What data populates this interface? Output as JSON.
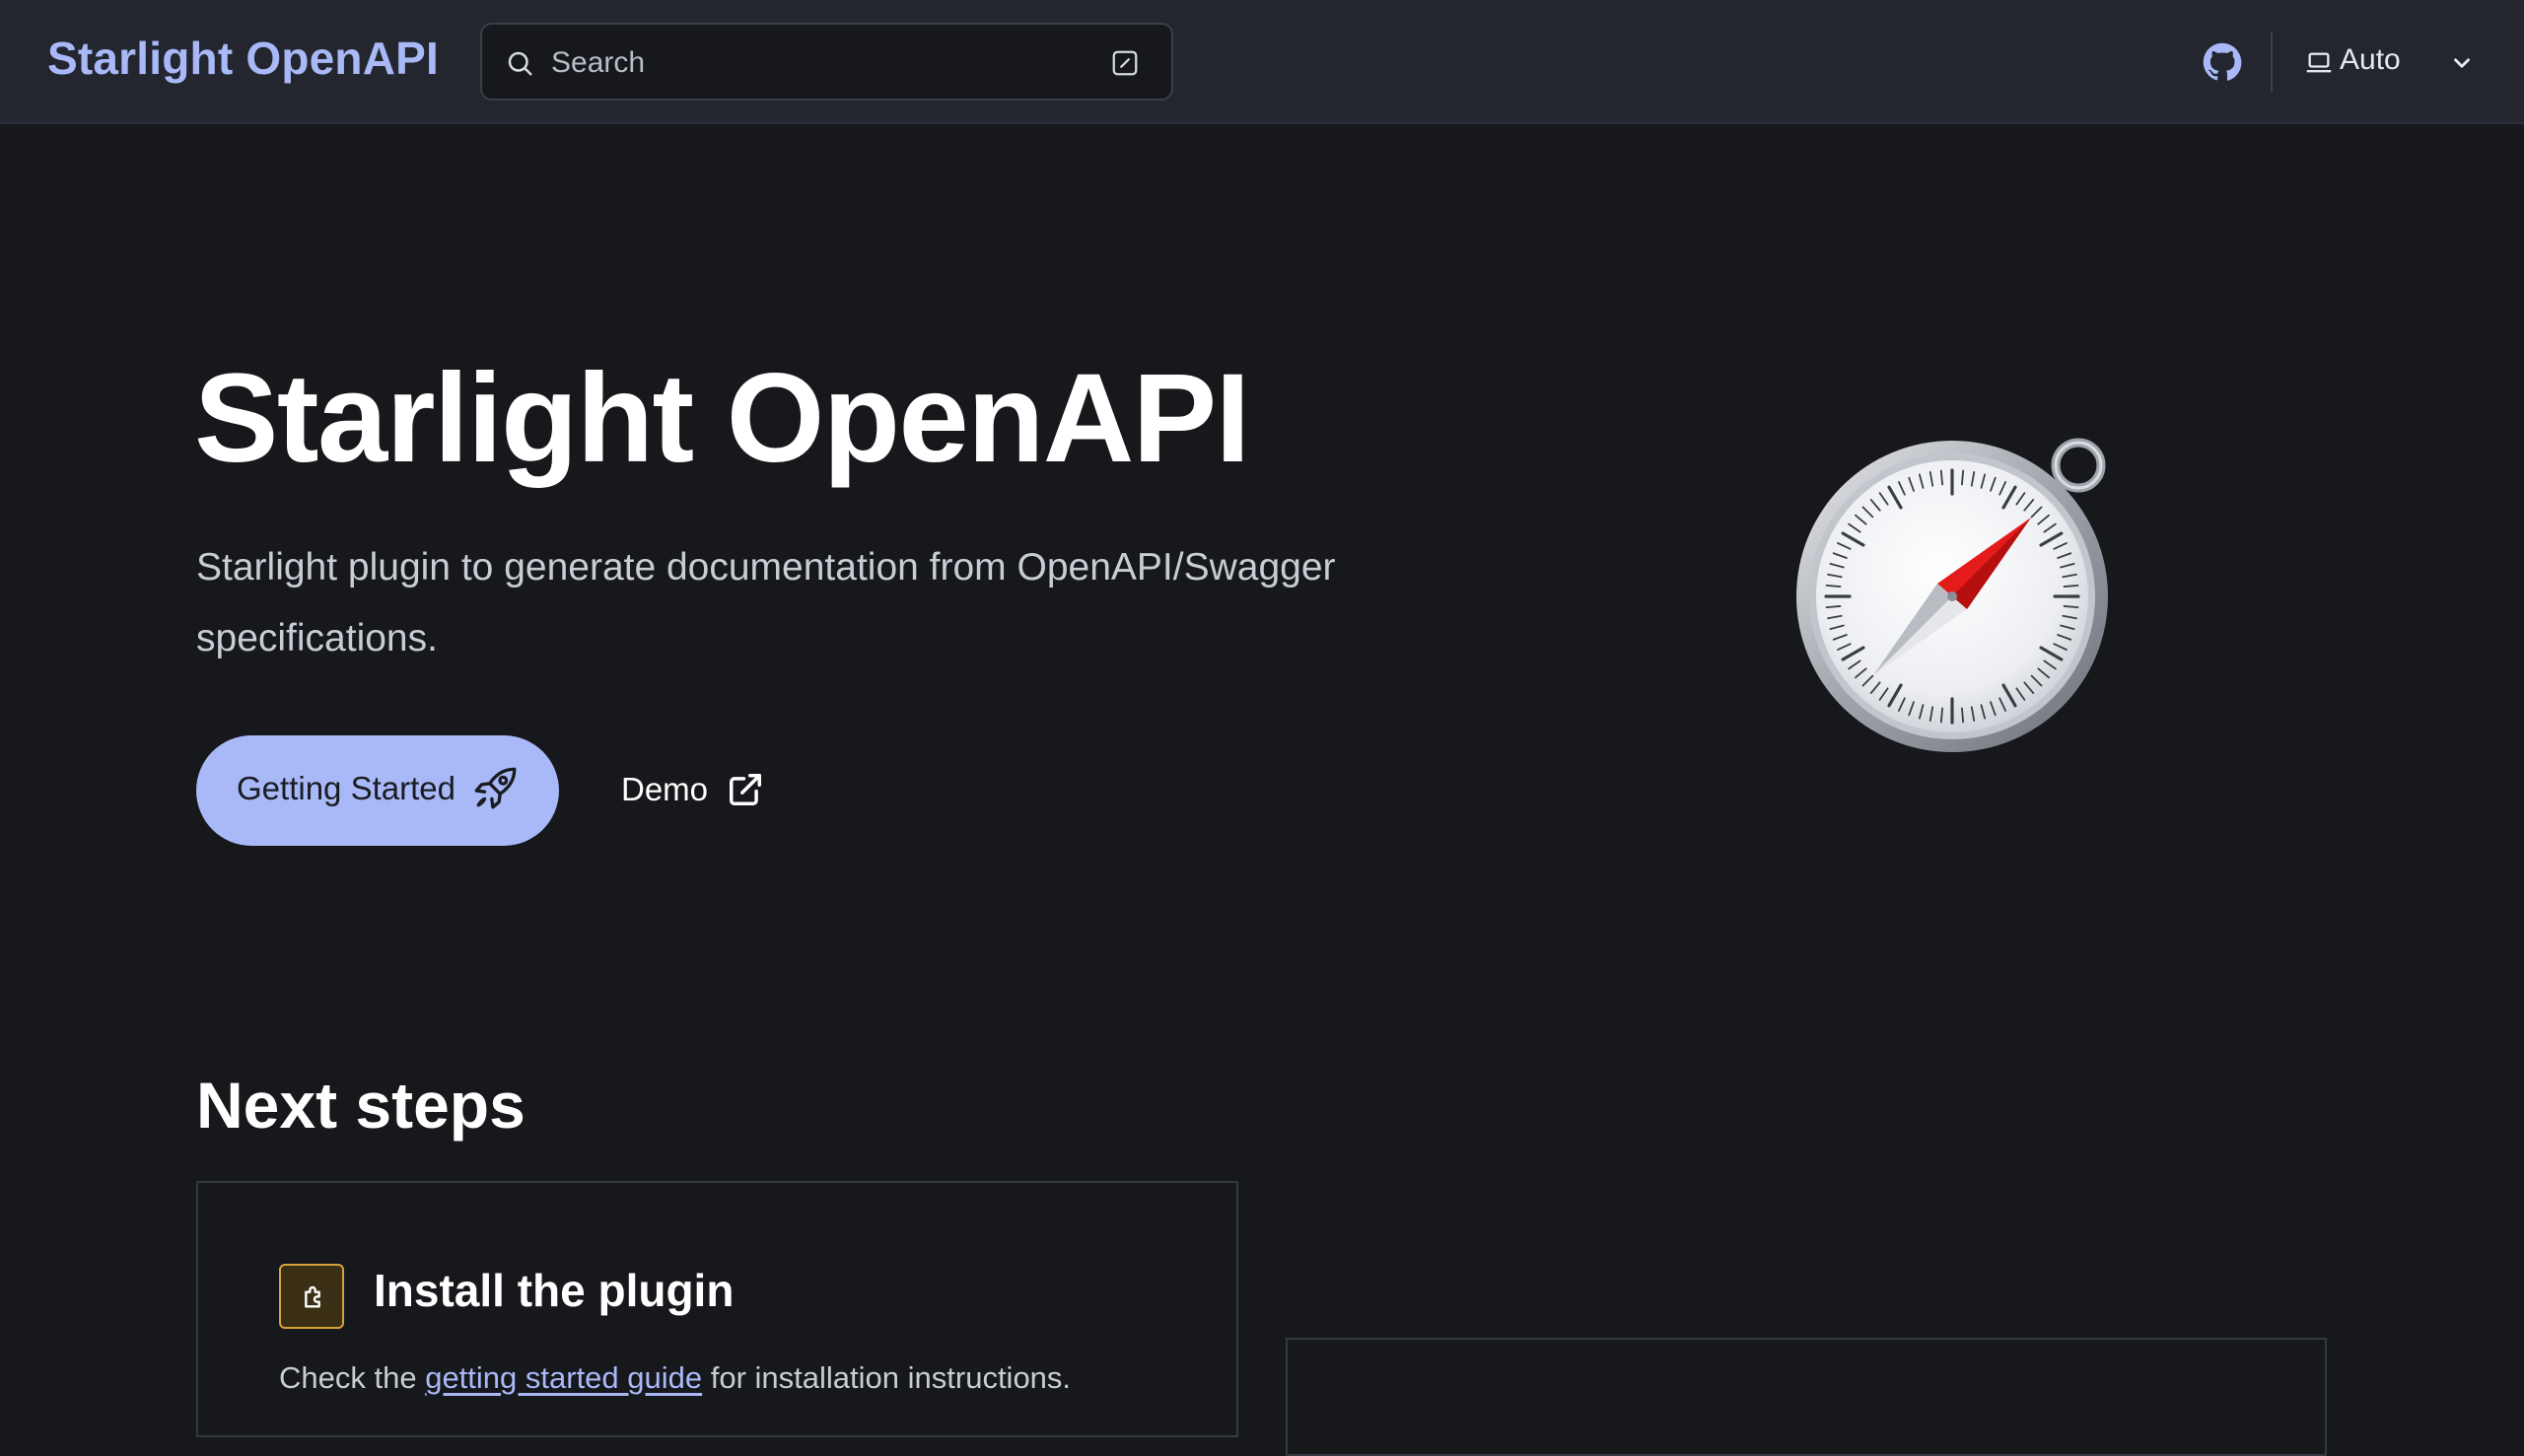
{
  "header": {
    "site_title": "Starlight OpenAPI",
    "search_placeholder": "Search",
    "theme_select_value": "Auto",
    "icons": [
      "search-icon",
      "keyboard-shortcut-icon",
      "github-icon",
      "laptop-icon",
      "chevron-down-icon"
    ]
  },
  "hero": {
    "title": "Starlight OpenAPI",
    "tagline": "Starlight plugin to generate documentation from OpenAPI/Swagger specifications.",
    "primary_action_label": "Getting Started",
    "secondary_action_label": "Demo",
    "image": "compass-icon"
  },
  "next_steps": {
    "heading": "Next steps",
    "cards": [
      {
        "title": "Install the plugin",
        "icon": "plugin-icon",
        "text_before": "Check the ",
        "link_text": "getting started guide",
        "text_after": " for installation instructions."
      }
    ]
  },
  "colors": {
    "accent": "#a9b8f7",
    "background": "#17181c",
    "header_background": "#23262f",
    "card_icon_border": "#d4a43a"
  }
}
